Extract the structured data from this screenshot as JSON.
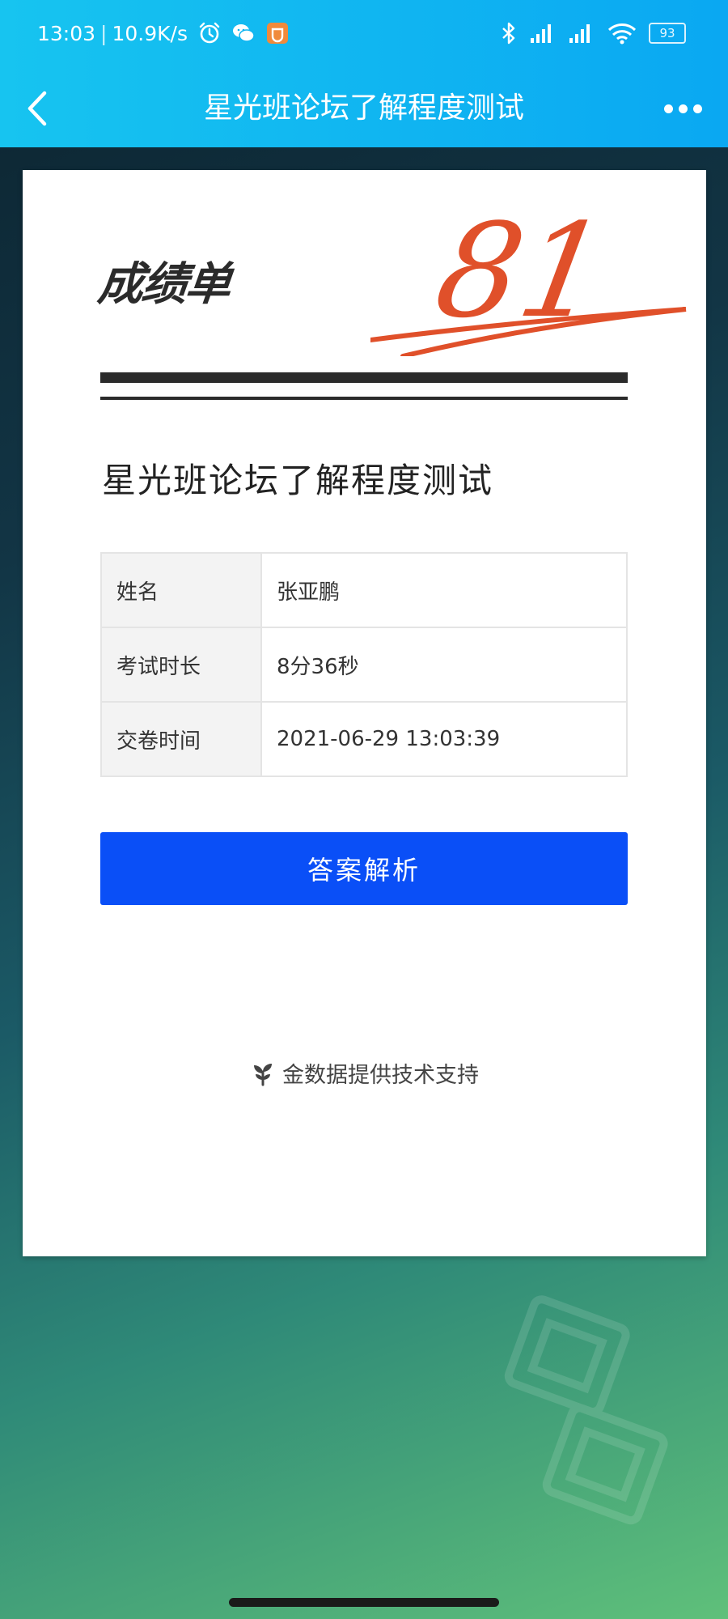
{
  "status_bar": {
    "time": "13:03",
    "network_speed": "10.9K/s",
    "battery_level": "93",
    "icons": [
      "alarm-icon",
      "wechat-icon",
      "app-notification-icon",
      "bluetooth-icon",
      "signal-icon",
      "wifi-icon",
      "battery-icon"
    ]
  },
  "navbar": {
    "title": "星光班论坛了解程度测试",
    "back_icon": "chevron-left-icon",
    "more_icon": "more-dots-icon"
  },
  "report": {
    "heading": "成绩单",
    "score": "81",
    "score_color": "#e0502a",
    "quiz_title": "星光班论坛了解程度测试",
    "rows": [
      {
        "label": "姓名",
        "value": "张亚鹏"
      },
      {
        "label": "考试时长",
        "value": "8分36秒"
      },
      {
        "label": "交卷时间",
        "value": "2021-06-29 13:03:39"
      }
    ],
    "analysis_button_label": "答案解析",
    "button_color": "#0a4ff7",
    "footer_text": "金数据提供技术支持",
    "footer_icon": "sprout-icon"
  }
}
